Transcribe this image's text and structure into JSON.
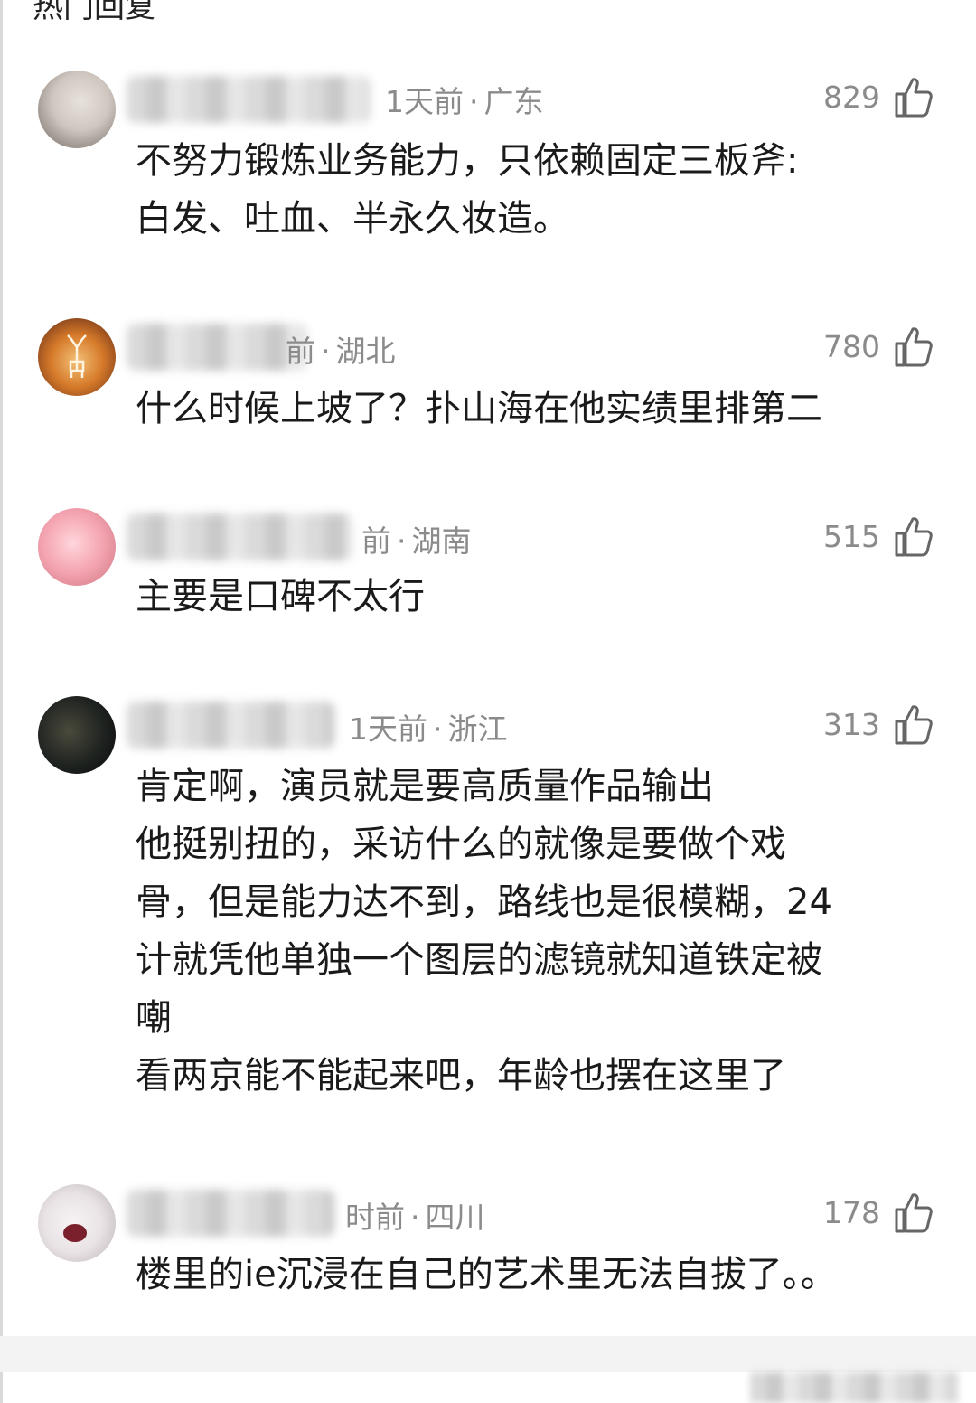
{
  "section": {
    "title": "热门回复"
  },
  "comments": [
    {
      "time": "1天前",
      "location": "广东",
      "likes": "829",
      "text": "不努力锻炼业务能力，只依赖固定三板斧:\n白发、吐血、半永久妆造。"
    },
    {
      "time": "前",
      "location": "湖北",
      "likes": "780",
      "text": "什么时候上坡了？扑山海在他实绩里排第二"
    },
    {
      "time": "前",
      "location": "湖南",
      "likes": "515",
      "text": "主要是口碑不太行"
    },
    {
      "time": "1天前",
      "location": "浙江",
      "likes": "313",
      "text": "肯定啊，演员就是要高质量作品输出\n他挺别扭的，采访什么的就像是要做个戏\n骨，但是能力达不到，路线也是很模糊，24\n计就凭他单独一个图层的滤镜就知道铁定被\n嘲\n看两京能不能起来吧，年龄也摆在这里了"
    },
    {
      "time": "时前",
      "location": "四川",
      "likes": "178",
      "text": "楼里的ie沉浸在自己的艺术里无法自拔了。。"
    }
  ],
  "icons": {
    "like": "thumbs-up-icon"
  },
  "colors": {
    "meta": "#8b8b8b",
    "text": "#1a1a1a"
  }
}
